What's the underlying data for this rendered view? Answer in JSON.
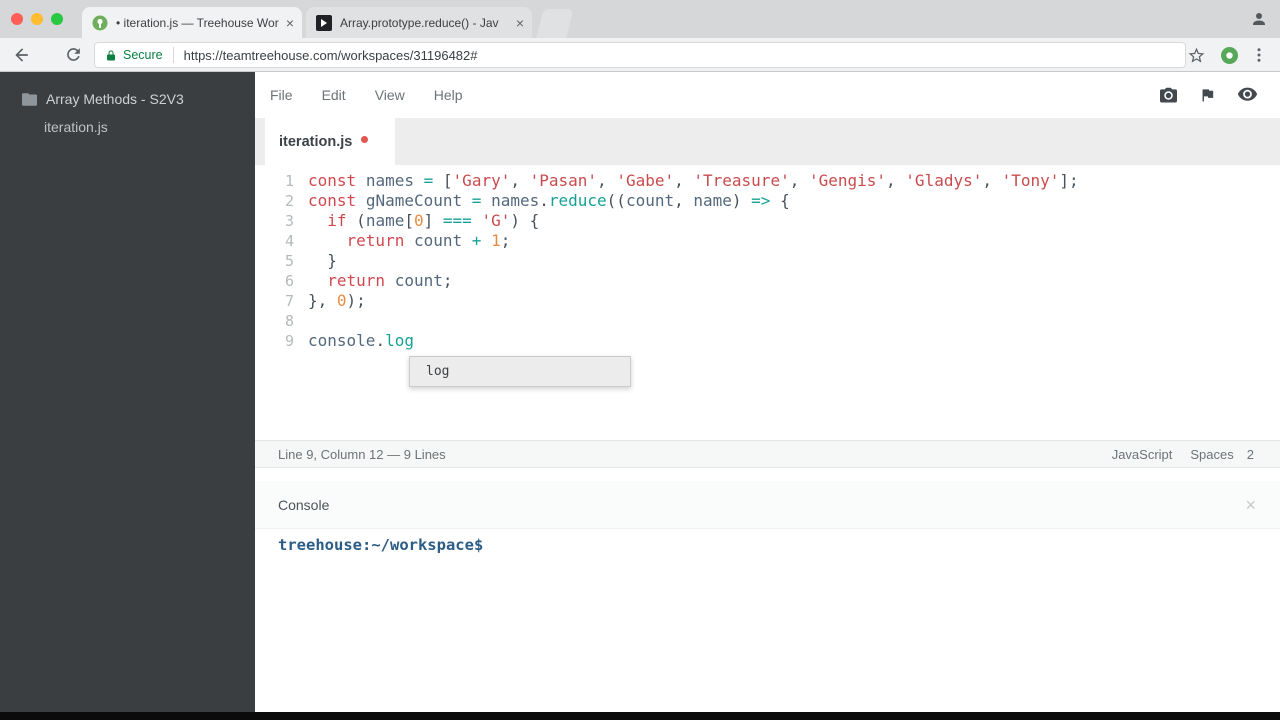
{
  "browser": {
    "traffic_lights": [
      "#ff5f57",
      "#febc2e",
      "#28c840"
    ],
    "tabs": [
      {
        "title": "• iteration.js — Treehouse Wor",
        "close_label": "×"
      },
      {
        "title": "Array.prototype.reduce() - Jav",
        "close_label": "×"
      }
    ],
    "toolbar": {
      "secure_label": "Secure",
      "url": "https://teamtreehouse.com/workspaces/31196482#"
    }
  },
  "workspace": {
    "sidebar": {
      "project_name": "Array Methods - S2V3",
      "file_name": "iteration.js"
    },
    "menubar": {
      "items": [
        "File",
        "Edit",
        "View",
        "Help"
      ]
    },
    "editor": {
      "tab_label": "iteration.js",
      "code_lines": [
        {
          "num": "1",
          "tokens": [
            {
              "t": "const",
              "c": "kw"
            },
            {
              "t": " ",
              "c": "pl"
            },
            {
              "t": "names",
              "c": "id"
            },
            {
              "t": " ",
              "c": "pl"
            },
            {
              "t": "=",
              "c": "op"
            },
            {
              "t": " ",
              "c": "pl"
            },
            {
              "t": "[",
              "c": "pun"
            },
            {
              "t": "'Gary'",
              "c": "str"
            },
            {
              "t": ", ",
              "c": "pun"
            },
            {
              "t": "'Pasan'",
              "c": "str"
            },
            {
              "t": ", ",
              "c": "pun"
            },
            {
              "t": "'Gabe'",
              "c": "str"
            },
            {
              "t": ", ",
              "c": "pun"
            },
            {
              "t": "'Treasure'",
              "c": "str"
            },
            {
              "t": ", ",
              "c": "pun"
            },
            {
              "t": "'Gengis'",
              "c": "str"
            },
            {
              "t": ", ",
              "c": "pun"
            },
            {
              "t": "'Gladys'",
              "c": "str"
            },
            {
              "t": ", ",
              "c": "pun"
            },
            {
              "t": "'Tony'",
              "c": "str"
            },
            {
              "t": "];",
              "c": "pun"
            }
          ]
        },
        {
          "num": "2",
          "tokens": [
            {
              "t": "const",
              "c": "kw"
            },
            {
              "t": " ",
              "c": "pl"
            },
            {
              "t": "gNameCount",
              "c": "id"
            },
            {
              "t": " ",
              "c": "pl"
            },
            {
              "t": "=",
              "c": "op"
            },
            {
              "t": " ",
              "c": "pl"
            },
            {
              "t": "names",
              "c": "id"
            },
            {
              "t": ".",
              "c": "pun"
            },
            {
              "t": "reduce",
              "c": "fn"
            },
            {
              "t": "((",
              "c": "pun"
            },
            {
              "t": "count",
              "c": "id"
            },
            {
              "t": ", ",
              "c": "pun"
            },
            {
              "t": "name",
              "c": "id"
            },
            {
              "t": ") ",
              "c": "pun"
            },
            {
              "t": "=>",
              "c": "op"
            },
            {
              "t": " {",
              "c": "pun"
            }
          ]
        },
        {
          "num": "3",
          "tokens": [
            {
              "t": "  ",
              "c": "pl"
            },
            {
              "t": "if",
              "c": "kw"
            },
            {
              "t": " ",
              "c": "pl"
            },
            {
              "t": "(",
              "c": "pun"
            },
            {
              "t": "name",
              "c": "id"
            },
            {
              "t": "[",
              "c": "pun"
            },
            {
              "t": "0",
              "c": "num"
            },
            {
              "t": "]",
              "c": "pun"
            },
            {
              "t": " ",
              "c": "pl"
            },
            {
              "t": "===",
              "c": "op"
            },
            {
              "t": " ",
              "c": "pl"
            },
            {
              "t": "'G'",
              "c": "str"
            },
            {
              "t": ") {",
              "c": "pun"
            }
          ]
        },
        {
          "num": "4",
          "tokens": [
            {
              "t": "    ",
              "c": "pl"
            },
            {
              "t": "return",
              "c": "kw"
            },
            {
              "t": " ",
              "c": "pl"
            },
            {
              "t": "count",
              "c": "id"
            },
            {
              "t": " ",
              "c": "pl"
            },
            {
              "t": "+",
              "c": "op"
            },
            {
              "t": " ",
              "c": "pl"
            },
            {
              "t": "1",
              "c": "num"
            },
            {
              "t": ";",
              "c": "pun"
            }
          ]
        },
        {
          "num": "5",
          "tokens": [
            {
              "t": "  }",
              "c": "pun"
            }
          ]
        },
        {
          "num": "6",
          "tokens": [
            {
              "t": "  ",
              "c": "pl"
            },
            {
              "t": "return",
              "c": "kw"
            },
            {
              "t": " ",
              "c": "pl"
            },
            {
              "t": "count",
              "c": "id"
            },
            {
              "t": ";",
              "c": "pun"
            }
          ]
        },
        {
          "num": "7",
          "tokens": [
            {
              "t": "},",
              "c": "pun"
            },
            {
              "t": " ",
              "c": "pl"
            },
            {
              "t": "0",
              "c": "num"
            },
            {
              "t": ");",
              "c": "pun"
            }
          ]
        },
        {
          "num": "8",
          "tokens": []
        },
        {
          "num": "9",
          "tokens": [
            {
              "t": "console",
              "c": "id"
            },
            {
              "t": ".",
              "c": "pun"
            },
            {
              "t": "log",
              "c": "fn"
            }
          ]
        }
      ],
      "autocomplete_items": [
        "log"
      ],
      "statusbar": {
        "position_text": "Line 9, Column 12 — 9 Lines",
        "language": "JavaScript",
        "indent_label": "Spaces",
        "indent_value": "2"
      }
    },
    "console": {
      "title": "Console",
      "close_label": "×",
      "prompt": "treehouse:~/workspace$"
    },
    "syntax_colors": {
      "keyword": "#d1494f",
      "string": "#c94b4d",
      "identifier": "#54687d",
      "operator": "#16a295",
      "number": "#e78c45",
      "function": "#16a295",
      "punctuation": "#47525c",
      "line_number": "#b5b9bc"
    }
  }
}
